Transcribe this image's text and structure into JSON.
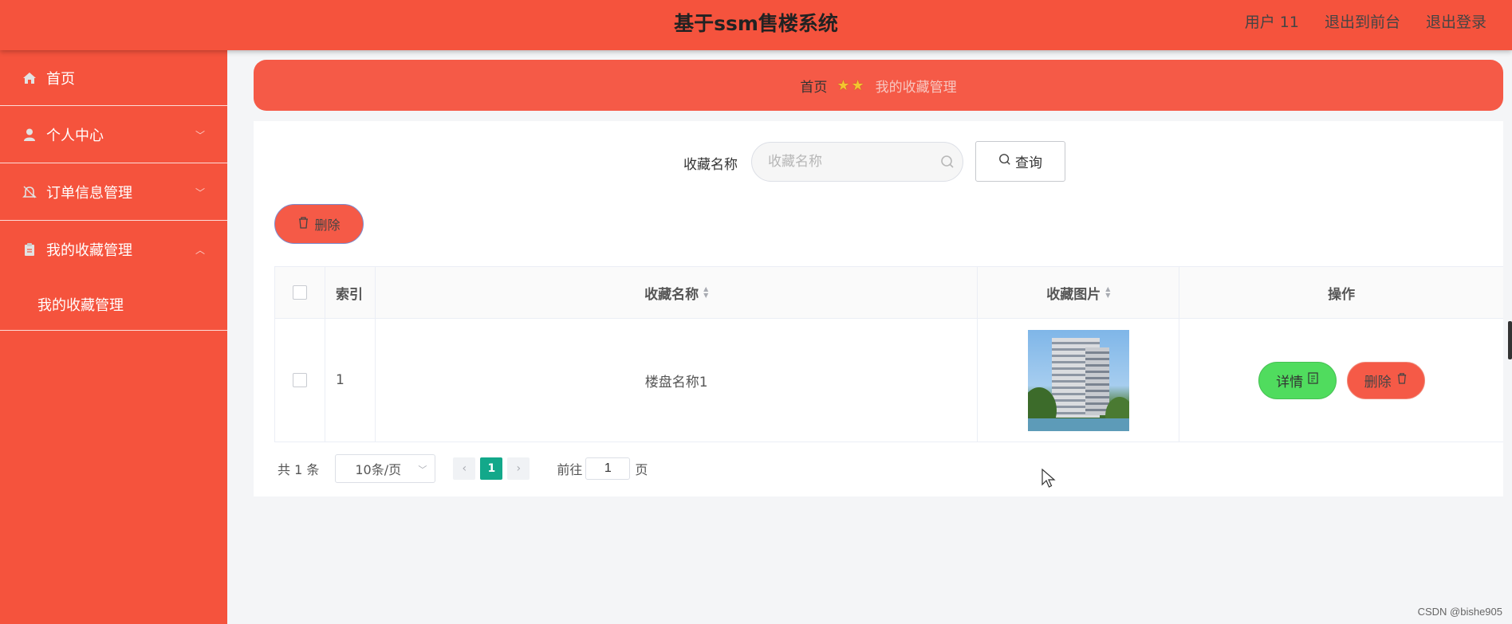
{
  "header": {
    "title": "基于ssm售楼系统",
    "user_label": "用户 11",
    "front_link": "退出到前台",
    "logout_link": "退出登录"
  },
  "sidebar": {
    "items": [
      {
        "label": "首页",
        "icon": "home-icon"
      },
      {
        "label": "个人中心",
        "icon": "user-icon",
        "expandable": true
      },
      {
        "label": "订单信息管理",
        "icon": "bell-icon",
        "expandable": true
      },
      {
        "label": "我的收藏管理",
        "icon": "clipboard-icon",
        "expanded": true
      }
    ],
    "subitem": "我的收藏管理"
  },
  "breadcrumb": {
    "home": "首页",
    "stars": "★★",
    "current": "我的收藏管理"
  },
  "search": {
    "label": "收藏名称",
    "placeholder": "收藏名称",
    "value": "",
    "button_label": "查询"
  },
  "toolbar": {
    "delete_label": "删除"
  },
  "table": {
    "columns": [
      "",
      "索引",
      "收藏名称",
      "收藏图片",
      "操作"
    ],
    "rows": [
      {
        "index": "1",
        "name": "楼盘名称1",
        "image": "building-photo"
      }
    ],
    "detail_label": "详情",
    "delete_label": "删除"
  },
  "pagination": {
    "total": "共 1 条",
    "page_size": "10条/页",
    "current_page": "1",
    "goto_prefix": "前往",
    "goto_value": "1",
    "goto_suffix": "页"
  },
  "watermark": "CSDN @bishe905",
  "colors": {
    "primary": "#f5533d",
    "success": "#50dc5e",
    "page_active": "#13a88a"
  }
}
